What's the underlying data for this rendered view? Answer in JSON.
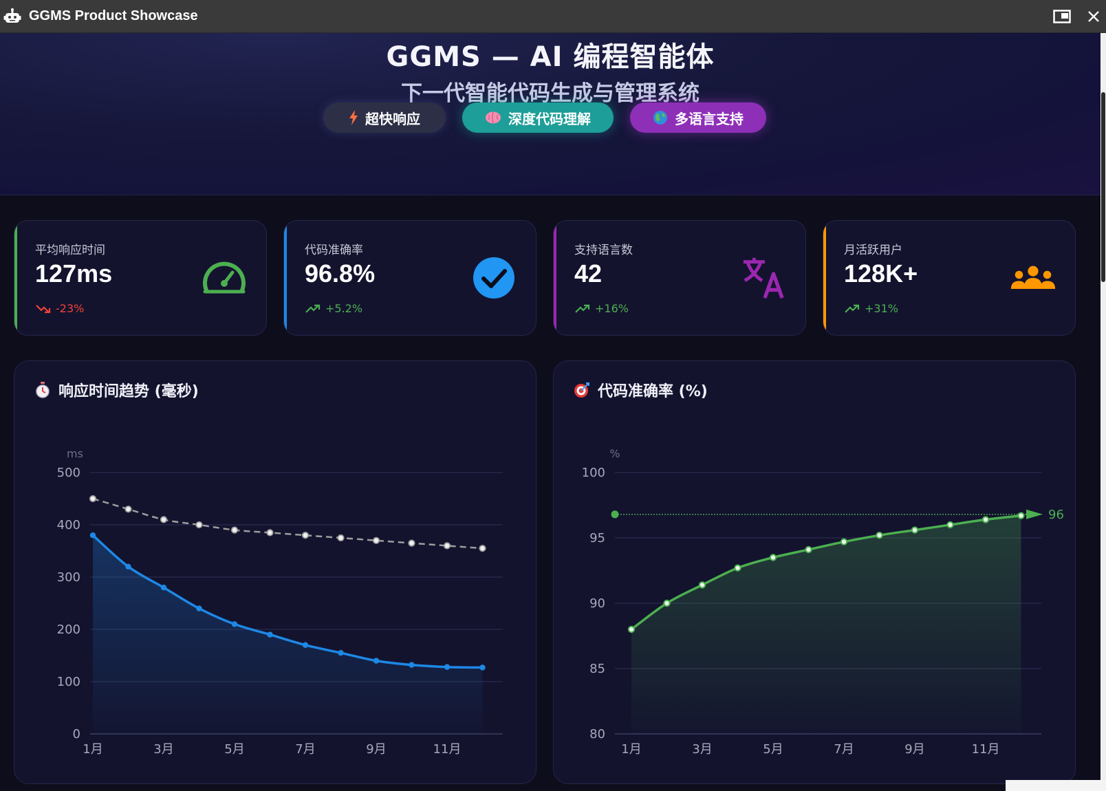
{
  "window": {
    "title": "GGMS Product Showcase"
  },
  "hero": {
    "title": "GGMS — AI 编程智能体",
    "subtitle": "下一代智能代码生成与管理系统",
    "pills": [
      {
        "label": "超快响应",
        "icon": "lightning-icon"
      },
      {
        "label": "深度代码理解",
        "icon": "brain-icon"
      },
      {
        "label": "多语言支持",
        "icon": "globe-icon"
      }
    ]
  },
  "stats": [
    {
      "label": "平均响应时间",
      "value": "127ms",
      "trend": "-23%",
      "trend_dir": "down",
      "accent": "#4caf50",
      "icon": "speedometer-icon",
      "icon_color": "#4caf50"
    },
    {
      "label": "代码准确率",
      "value": "96.8%",
      "trend": "+5.2%",
      "trend_dir": "up",
      "accent": "#1e88e5",
      "icon": "check-circle-icon",
      "icon_color": "#2196f3"
    },
    {
      "label": "支持语言数",
      "value": "42",
      "trend": "+16%",
      "trend_dir": "up",
      "accent": "#9c27b0",
      "icon": "translate-icon",
      "icon_color": "#9c27b0"
    },
    {
      "label": "月活跃用户",
      "value": "128K+",
      "trend": "+31%",
      "trend_dir": "up",
      "accent": "#ff9800",
      "icon": "users-icon",
      "icon_color": "#ff9800"
    }
  ],
  "colors": {
    "trend_up": "#4caf50",
    "trend_down": "#f44336",
    "response_line": "#1e88e5",
    "baseline_line": "#9e9e9e",
    "accuracy_line": "#4caf50"
  },
  "chart_data": [
    {
      "type": "line",
      "title": "响应时间趋势 (毫秒)",
      "title_icon": "stopwatch-icon",
      "yunit": "ms",
      "ylim": [
        0,
        500
      ],
      "yticks": [
        0,
        100,
        200,
        300,
        400,
        500
      ],
      "categories": [
        "1月",
        "2月",
        "3月",
        "4月",
        "5月",
        "6月",
        "7月",
        "8月",
        "9月",
        "10月",
        "11月",
        "12月"
      ],
      "xtick_labels": [
        "1月",
        "3月",
        "5月",
        "7月",
        "9月",
        "11月"
      ],
      "grid": true,
      "series": [
        {
          "values": [
            450,
            430,
            410,
            400,
            390,
            385,
            380,
            375,
            370,
            365,
            360,
            355
          ],
          "style": "dashed",
          "color": "#9e9e9e"
        },
        {
          "values": [
            380,
            320,
            280,
            240,
            210,
            190,
            170,
            155,
            140,
            132,
            128,
            127
          ],
          "style": "solid",
          "color": "#1e88e5",
          "area": true
        }
      ]
    },
    {
      "type": "line",
      "title": "代码准确率 (%)",
      "title_icon": "target-icon",
      "yunit": "%",
      "ylim": [
        80,
        100
      ],
      "yticks": [
        80,
        85,
        90,
        95,
        100
      ],
      "categories": [
        "1月",
        "2月",
        "3月",
        "4月",
        "5月",
        "6月",
        "7月",
        "8月",
        "9月",
        "10月",
        "11月",
        "12月"
      ],
      "xtick_labels": [
        "1月",
        "3月",
        "5月",
        "7月",
        "9月",
        "11月"
      ],
      "grid": true,
      "markline": {
        "value": 96.8,
        "label": "96"
      },
      "series": [
        {
          "values": [
            88.0,
            90.0,
            91.4,
            92.7,
            93.5,
            94.1,
            94.7,
            95.2,
            95.6,
            96.0,
            96.4,
            96.7
          ],
          "style": "solid",
          "color": "#4caf50",
          "area": true
        }
      ]
    }
  ]
}
